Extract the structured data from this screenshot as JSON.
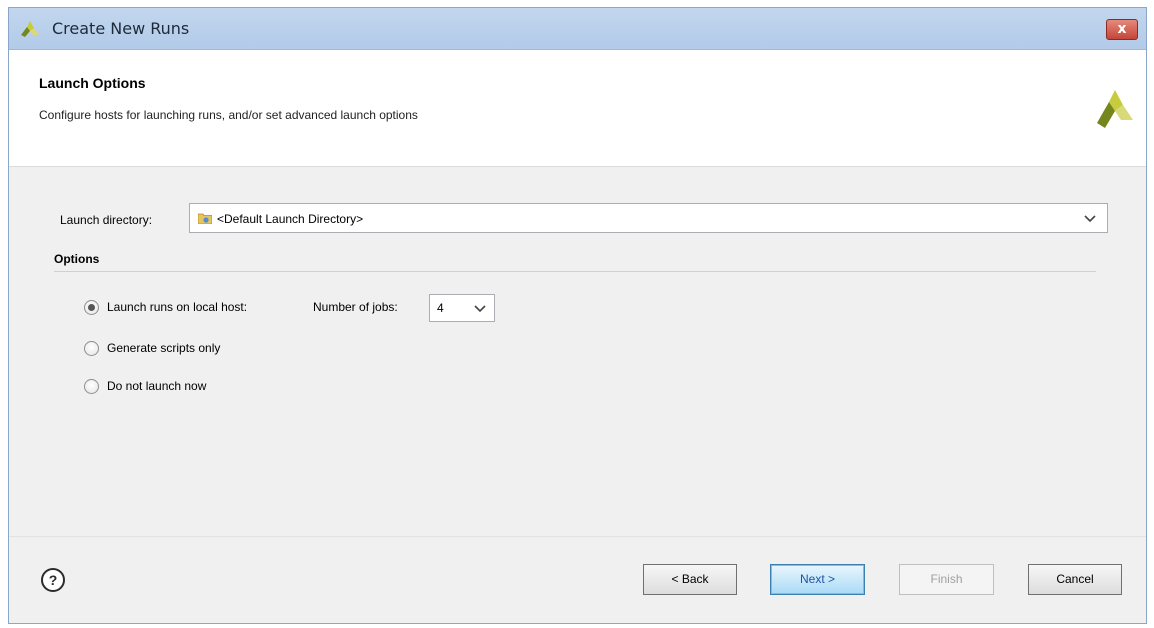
{
  "window": {
    "title": "Create New Runs",
    "close_label": "x"
  },
  "header": {
    "title": "Launch Options",
    "subtitle": "Configure hosts for launching runs, and/or set advanced launch options"
  },
  "launch_directory": {
    "label": "Launch directory:",
    "value": "<Default Launch Directory>"
  },
  "options": {
    "title": "Options",
    "local_host": {
      "label": "Launch runs on local host:",
      "selected": true
    },
    "jobs": {
      "label": "Number of jobs:",
      "value": "4"
    },
    "scripts_only": {
      "label": "Generate scripts only",
      "selected": false
    },
    "no_launch": {
      "label": "Do not launch now",
      "selected": false
    }
  },
  "footer": {
    "help_label": "?",
    "back_label": "< Back",
    "next_label": "Next >",
    "finish_label": "Finish",
    "cancel_label": "Cancel"
  },
  "colors": {
    "titlebar": "#b2cbe9",
    "close_button": "#c4453a",
    "next_button_border": "#3c7fb1",
    "logo_yellow": "#c8cc3c",
    "logo_green": "#74861c"
  }
}
